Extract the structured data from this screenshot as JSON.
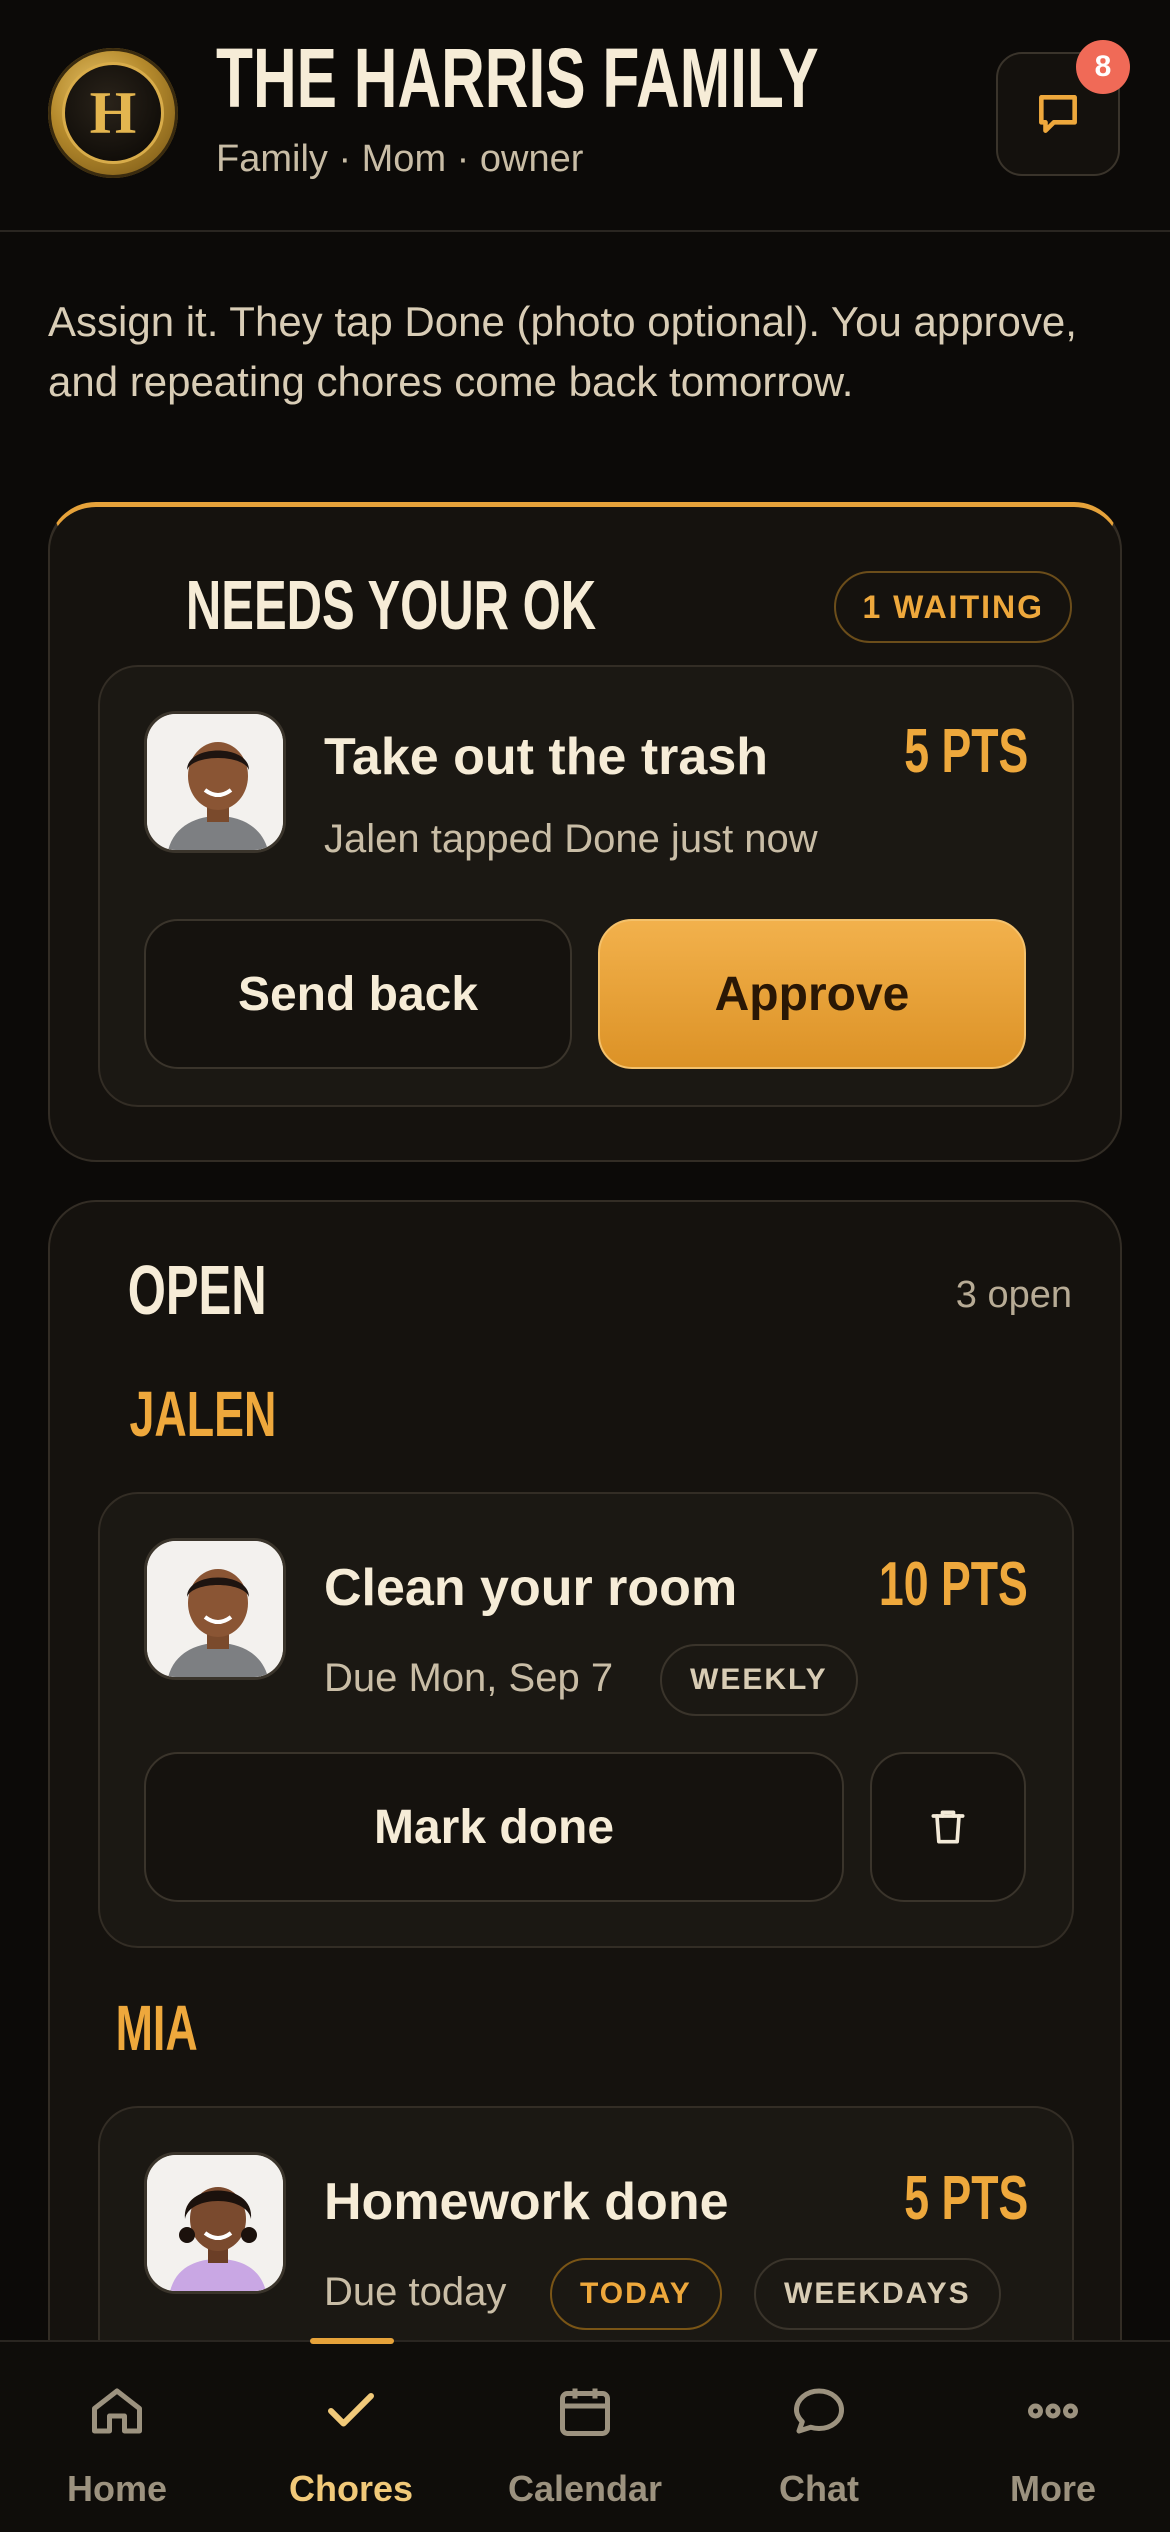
{
  "header": {
    "crest_letter": "H",
    "title": "THE HARRIS FAMILY",
    "subtitle": "Family · Mom · owner",
    "notifications_count": "8"
  },
  "intro": "Assign it. They tap Done (photo optional). You approve, and repeating chores come back tomorrow.",
  "needs_ok": {
    "title": "NEEDS YOUR OK",
    "waiting_label": "1 WAITING",
    "item": {
      "title": "Take out the trash",
      "points": "5 PTS",
      "status": "Jalen tapped Done just now",
      "send_back_label": "Send back",
      "approve_label": "Approve"
    }
  },
  "open": {
    "title": "OPEN",
    "count_label": "3 open",
    "groups": [
      {
        "kid": "JALEN",
        "chore": {
          "title": "Clean your room",
          "points": "10 PTS",
          "due": "Due Mon, Sep 7",
          "tags": [
            "WEEKLY"
          ],
          "mark_done_label": "Mark done"
        }
      },
      {
        "kid": "MIA",
        "chore": {
          "title": "Homework done",
          "points": "5 PTS",
          "due": "Due today",
          "tags": [
            "TODAY",
            "WEEKDAYS"
          ]
        }
      }
    ]
  },
  "nav": {
    "items": [
      {
        "label": "Home",
        "icon": "home-icon"
      },
      {
        "label": "Chores",
        "icon": "check-icon",
        "active": true
      },
      {
        "label": "Calendar",
        "icon": "calendar-icon"
      },
      {
        "label": "Chat",
        "icon": "chat-bubble-icon"
      },
      {
        "label": "More",
        "icon": "more-dots-icon"
      }
    ]
  },
  "colors": {
    "background": "#0c0a08",
    "accent": "#eea83c",
    "badge": "#f06a57"
  }
}
